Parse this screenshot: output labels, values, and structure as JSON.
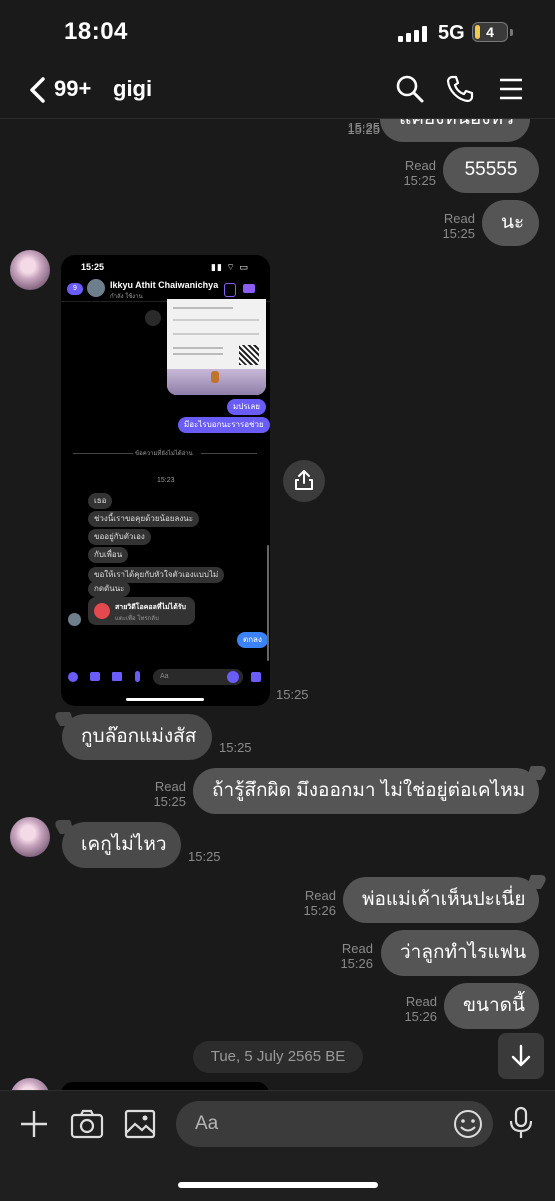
{
  "status_bar": {
    "time": "18:04",
    "network": "5G",
    "battery": "4"
  },
  "header": {
    "back_count": "99+",
    "contact_name": "gigi"
  },
  "messages": [
    {
      "text": "แค่ยังหน่องห่ว",
      "time": "15:25",
      "side": "sent"
    },
    {
      "text": "55555",
      "status": "Read",
      "time": "15:25",
      "side": "sent"
    },
    {
      "text": "นะ",
      "status": "Read",
      "time": "15:25",
      "side": "sent"
    },
    {
      "text": "กูบล๊อกแม่งสัส",
      "time": "15:25",
      "side": "received"
    },
    {
      "text": "ถ้ารู้สึกผิด มึงออกมา ไม่ใช่อยู่ต่อเคไหม",
      "status": "Read",
      "time": "15:25",
      "side": "sent"
    },
    {
      "text": "เคกูไม่ไหว",
      "time": "15:25",
      "side": "received"
    },
    {
      "text": "พ่อแม่เค้าเห็นปะเนี่ย",
      "status": "Read",
      "time": "15:26",
      "side": "sent"
    },
    {
      "text": "ว่าลูกทำไรแฟน",
      "status": "Read",
      "time": "15:26",
      "side": "sent"
    },
    {
      "text": "ขนาดนี้",
      "status": "Read",
      "time": "15:26",
      "side": "sent"
    }
  ],
  "shared_image": {
    "time": "15:25",
    "status_time": "15:25",
    "badge": "9",
    "contact": "Ikkyu Athit Chaiwanichya",
    "sub": "กำลัง ใช้งาน",
    "sent_msgs": [
      "มปรเลย",
      "มีอะไรบอกนะรารอช่วย"
    ],
    "unread_divider": "ข้อความที่ยังไม่ได้อ่าน",
    "time_label": "15:23",
    "received_msgs": [
      "เธอ",
      "ช่วงนี้เราขอคุยด้วยน้อยลงนะ",
      "ขออยู่กับตัวเอง",
      "กับเพื่อน",
      "ขอให้เราได้คุยกับหัวใจตัวเองแบบไม่",
      "กดดันนะ"
    ],
    "missed_call": "สายวิดีโอคอลที่ไม่ได้รับ",
    "missed_call_sub": "แตะเพื่อ โทรกลับ",
    "last_sent": "ตกลง",
    "composer_placeholder": "Aa"
  },
  "date_divider": "Tue, 5 July 2565 BE",
  "composer": {
    "placeholder": "Aa"
  }
}
